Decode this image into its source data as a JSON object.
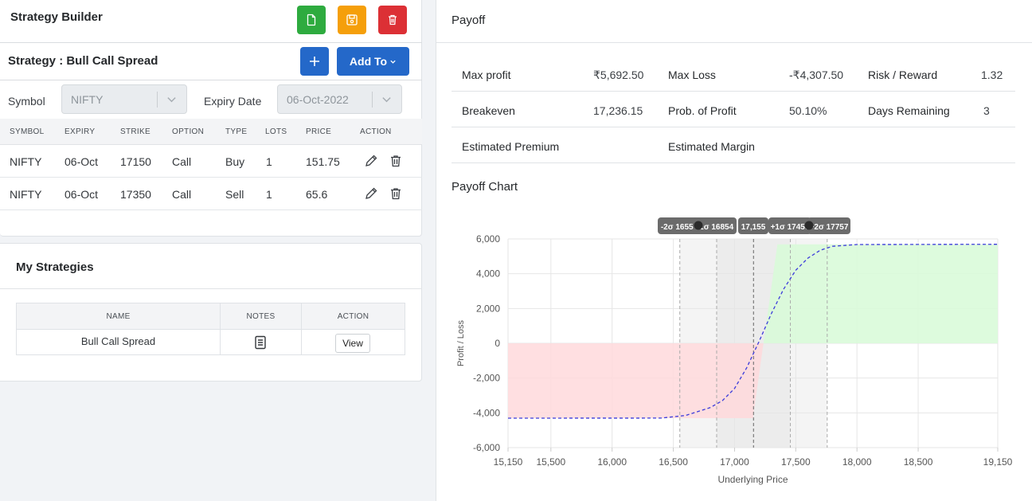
{
  "strategy_builder": {
    "title": "Strategy Builder",
    "strategy_title": "Strategy : Bull Call Spread",
    "add_to_label": "Add To",
    "symbol_label": "Symbol",
    "symbol_value": "NIFTY",
    "expiry_label": "Expiry Date",
    "expiry_value": "06-Oct-2022",
    "columns": [
      "SYMBOL",
      "EXPIRY",
      "STRIKE",
      "OPTION",
      "TYPE",
      "LOTS",
      "PRICE",
      "ACTION"
    ],
    "rows": [
      [
        "NIFTY",
        "06-Oct",
        "17150",
        "Call",
        "Buy",
        "1",
        "151.75"
      ],
      [
        "NIFTY",
        "06-Oct",
        "17350",
        "Call",
        "Sell",
        "1",
        "65.6"
      ]
    ]
  },
  "my_strategies": {
    "title": "My Strategies",
    "columns": [
      "NAME",
      "NOTES",
      "ACTION"
    ],
    "rows": [
      {
        "name": "Bull Call Spread",
        "action": "View"
      }
    ]
  },
  "payoff": {
    "title": "Payoff",
    "stats": [
      [
        {
          "label": "Max profit",
          "value": "₹5,692.50"
        },
        {
          "label": "Max Loss",
          "value": "-₹4,307.50"
        },
        {
          "label": "Risk / Reward",
          "value": "1.32"
        }
      ],
      [
        {
          "label": "Breakeven",
          "value": "17,236.15"
        },
        {
          "label": "Prob. of Profit",
          "value": "50.10%"
        },
        {
          "label": "Days Remaining",
          "value": "3"
        }
      ],
      [
        {
          "label": "Estimated Premium",
          "value": ""
        },
        {
          "label": "Estimated Margin",
          "value": ""
        }
      ]
    ],
    "chart_title": "Payoff Chart"
  },
  "colors": {
    "new": "#2eab3f",
    "save": "#f59f0a",
    "delete": "#dc3035",
    "primary": "#2468c9",
    "profit_fill": "#d9fbd9",
    "loss_fill": "#ffd9dc",
    "payoff_line": "#3b3bdb"
  },
  "icons": {
    "new": "file-icon",
    "save": "floppy-icon",
    "delete": "trash-icon",
    "add": "plus-icon",
    "edit": "pencil-icon",
    "remove": "trash-icon",
    "notes": "note-icon"
  },
  "chart_data": {
    "type": "area",
    "xlabel": "Underlying Price",
    "ylabel": "Profit / Loss",
    "xlim": [
      15150,
      19150
    ],
    "ylim": [
      -6000,
      6000
    ],
    "x_ticks": [
      15150,
      15500,
      16000,
      16500,
      17000,
      17500,
      18000,
      18500,
      19150
    ],
    "x_tick_labels": [
      "15,150",
      "15,500",
      "16,000",
      "16,500",
      "17,000",
      "17,500",
      "18,000",
      "18,500",
      "19,150"
    ],
    "y_ticks": [
      6000,
      4000,
      2000,
      0,
      -2000,
      -4000,
      -6000
    ],
    "y_tick_labels": [
      "6,000",
      "4,000",
      "2,000",
      "0",
      "-2,000",
      "-4,000",
      "-6,000"
    ],
    "grid": true,
    "series": [
      {
        "x": [
          15150,
          17150,
          17236.15,
          17350,
          19150
        ],
        "y": [
          -4307.5,
          -4307.5,
          0,
          5692.5,
          5692.5
        ]
      },
      {
        "x": [
          15150,
          16400,
          16600,
          16800,
          16900,
          17000,
          17100,
          17200,
          17300,
          17400,
          17500,
          17600,
          17700,
          17800,
          18000,
          19150
        ],
        "y": [
          -4307.5,
          -4300,
          -4150,
          -3700,
          -3300,
          -2600,
          -1400,
          100,
          1700,
          3100,
          4200,
          4900,
          5350,
          5580,
          5680,
          5692.5
        ]
      }
    ],
    "sd_lines": [
      {
        "x": 16553,
        "label": "-2σ 16553"
      },
      {
        "x": 16854,
        "label": "-1σ 16854"
      },
      {
        "x": 17155,
        "label": "17,155"
      },
      {
        "x": 17456,
        "label": "+1σ 17456"
      },
      {
        "x": 17757,
        "label": "+2σ 17757"
      }
    ]
  }
}
